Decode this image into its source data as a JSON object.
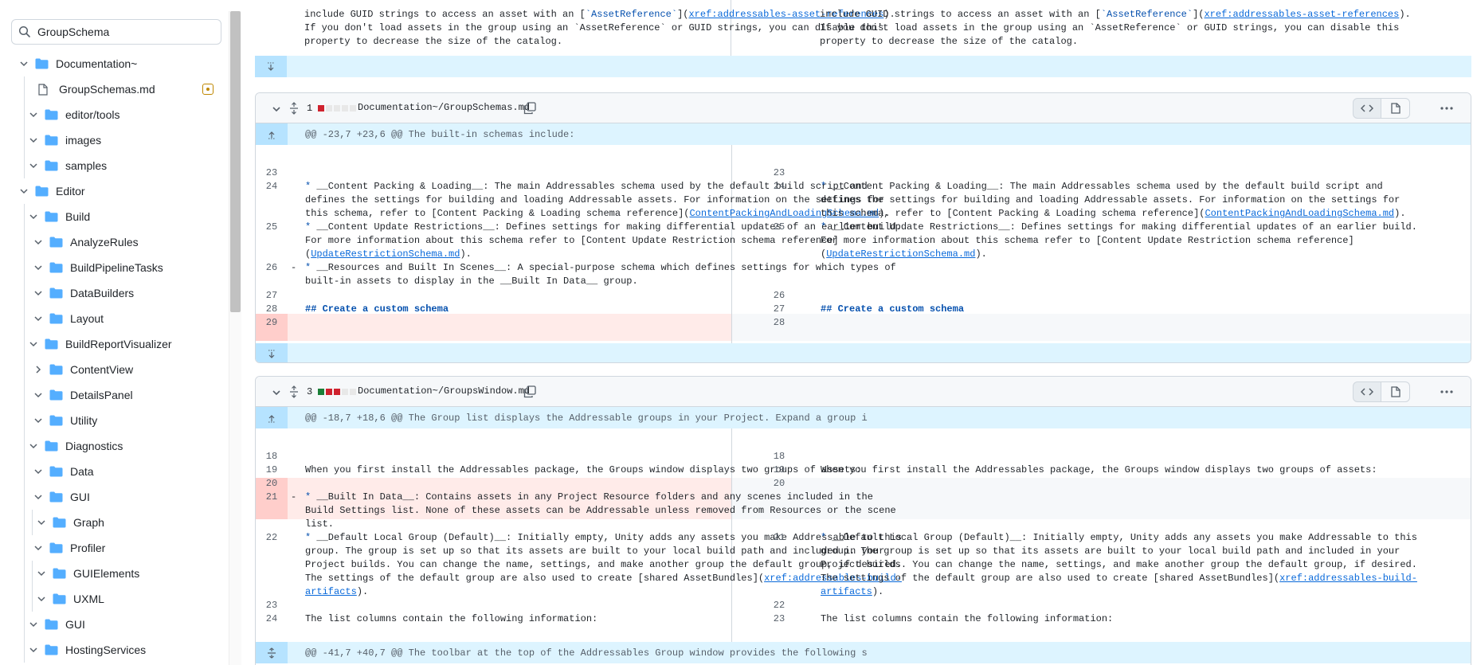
{
  "sidebar": {
    "search_value": "GroupSchema",
    "tree": [
      {
        "label": "Documentation~",
        "type": "folder",
        "level": 0,
        "expanded": true
      },
      {
        "label": "GroupSchemas.md",
        "type": "file",
        "level": 1,
        "modified": true
      },
      {
        "label": "editor/tools",
        "type": "folder",
        "level": 1,
        "expanded": true
      },
      {
        "label": "images",
        "type": "folder",
        "level": 1,
        "expanded": true
      },
      {
        "label": "samples",
        "type": "folder",
        "level": 1,
        "expanded": true
      },
      {
        "label": "Editor",
        "type": "folder",
        "level": 0,
        "expanded": true
      },
      {
        "label": "Build",
        "type": "folder",
        "level": 1,
        "expanded": true
      },
      {
        "label": "AnalyzeRules",
        "type": "folder",
        "level": 2,
        "expanded": true
      },
      {
        "label": "BuildPipelineTasks",
        "type": "folder",
        "level": 2,
        "expanded": true
      },
      {
        "label": "DataBuilders",
        "type": "folder",
        "level": 2,
        "expanded": true
      },
      {
        "label": "Layout",
        "type": "folder",
        "level": 2,
        "expanded": true
      },
      {
        "label": "BuildReportVisualizer",
        "type": "folder",
        "level": 1,
        "expanded": true
      },
      {
        "label": "ContentView",
        "type": "folder",
        "level": 2,
        "expanded": false
      },
      {
        "label": "DetailsPanel",
        "type": "folder",
        "level": 2,
        "expanded": true
      },
      {
        "label": "Utility",
        "type": "folder",
        "level": 2,
        "expanded": true
      },
      {
        "label": "Diagnostics",
        "type": "folder",
        "level": 1,
        "expanded": true
      },
      {
        "label": "Data",
        "type": "folder",
        "level": 2,
        "expanded": true
      },
      {
        "label": "GUI",
        "type": "folder",
        "level": 2,
        "expanded": true
      },
      {
        "label": "Graph",
        "type": "folder",
        "level": 3,
        "expanded": true
      },
      {
        "label": "Profiler",
        "type": "folder",
        "level": 2,
        "expanded": true
      },
      {
        "label": "GUIElements",
        "type": "folder",
        "level": 3,
        "expanded": true
      },
      {
        "label": "UXML",
        "type": "folder",
        "level": 3,
        "expanded": true
      },
      {
        "label": "GUI",
        "type": "folder",
        "level": 1,
        "expanded": true
      },
      {
        "label": "HostingServices",
        "type": "folder",
        "level": 1,
        "expanded": true
      }
    ]
  },
  "top_fragment": {
    "line1": "include GUID strings to access an asset with an [`AssetReference`](xref:addressables-asset-references).",
    "line2": "If you don't load assets in the group using an `AssetReference` or GUID strings, you can disable this",
    "line3": "property to decrease the size of the catalog."
  },
  "files": [
    {
      "changes": "1",
      "path": "Documentation~/GroupSchemas.md",
      "hunk": "@@ -23,7 +23,6 @@ The built-in schemas include:",
      "left": [
        {
          "n": "23",
          "text": ""
        },
        {
          "n": "24",
          "text": "* __Content Packing & Loading__: The main Addressables schema used by the default build script and\ndefines the settings for building and loading Addressable assets. For information on the settings for\nthis schema, refer to [Content Packing & Loading schema reference](ContentPackingAndLoadingSchema.md)."
        },
        {
          "n": "25",
          "text": "* __Content Update Restrictions__: Defines settings for making differential updates of an earlier build.\nFor more information about this schema refer to [Content Update Restriction schema reference]\n(UpdateRestrictionSchema.md)."
        },
        {
          "n": "26",
          "text": "* __Resources and Built In Scenes__: A special-purpose schema which defines settings for which types of\nbuilt-in assets to display in the __Built In Data__ group.",
          "deleted": true
        },
        {
          "n": "27",
          "text": ""
        },
        {
          "n": "28",
          "text": "## Create a custom schema"
        },
        {
          "n": "29",
          "text": ""
        }
      ],
      "right_nums": [
        "23",
        "24",
        "25",
        "26",
        "27",
        "28"
      ]
    },
    {
      "changes": "3",
      "path": "Documentation~/GroupsWindow.md",
      "hunk": "@@ -18,7 +18,6 @@ The Group list displays the Addressable groups in your Project. Expand a group i",
      "hunk2": "@@ -41,7 +40,7 @@ The toolbar at the top of the Addressables Group window provides the following s",
      "left_nums": [
        "18",
        "19",
        "20",
        "21",
        "22",
        "23",
        "24"
      ],
      "right_nums": [
        "18",
        "19",
        "20",
        "21",
        "22",
        "23"
      ],
      "line19": "When you first install the Addressables package, the Groups window displays two groups of assets:",
      "line21": "* __Built In Data__: Contains assets in any Project Resource folders and any scenes included in the\nBuild Settings list. None of these assets can be Addressable unless removed from Resources or the scene\nlist.",
      "line22": "* __Default Local Group (Default)__: Initially empty, Unity adds any assets you make Addressable to this\ngroup. The group is set up so that its assets are built to your local build path and included in your\nProject builds. You can change the name, settings, and make another group the default group, if desired.\nThe settings of the default group are also used to create [shared AssetBundles](xref:addressables-build-\nartifacts).",
      "line24": "The list columns contain the following information:"
    }
  ],
  "colors": {
    "deleted_bg": "#ffebe9",
    "deleted_num_bg": "#ffcecb",
    "hunk_bg": "#ddf4ff",
    "link": "#0969da",
    "accent_folder": "#54aeff"
  }
}
